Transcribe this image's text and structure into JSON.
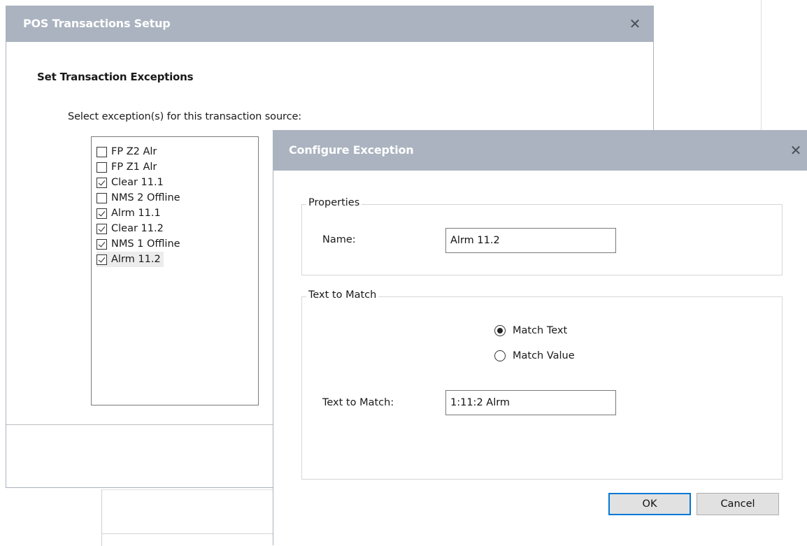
{
  "pos_dialog": {
    "title": "POS Transactions Setup",
    "section_heading": "Set Transaction Exceptions",
    "instruction": "Select exception(s) for this transaction source:",
    "exceptions": [
      {
        "label": "FP Z2 Alr",
        "checked": false
      },
      {
        "label": "FP Z1 Alr",
        "checked": false
      },
      {
        "label": "Clear 11.1",
        "checked": true
      },
      {
        "label": "NMS 2 Offline",
        "checked": false
      },
      {
        "label": "Alrm 11.1",
        "checked": true
      },
      {
        "label": "Clear 11.2",
        "checked": true
      },
      {
        "label": "NMS 1 Offline",
        "checked": true
      },
      {
        "label": "Alrm 11.2",
        "checked": true,
        "selected": true
      }
    ]
  },
  "config_dialog": {
    "title": "Configure Exception",
    "properties": {
      "legend": "Properties",
      "name_label": "Name:",
      "name_value": "Alrm 11.2"
    },
    "match": {
      "legend": "Text to Match",
      "options": [
        {
          "label": "Match Text",
          "checked": true
        },
        {
          "label": "Match Value",
          "checked": false
        }
      ],
      "text_label": "Text to Match:",
      "text_value": "1:11:2 Alrm"
    },
    "ok_label": "OK",
    "cancel_label": "Cancel"
  },
  "icons": {
    "close": "close-icon",
    "checkbox": "checkbox",
    "radio": "radio-button"
  },
  "colors": {
    "titlebar": "#aab3bf",
    "default_button_border": "#0078d7"
  }
}
